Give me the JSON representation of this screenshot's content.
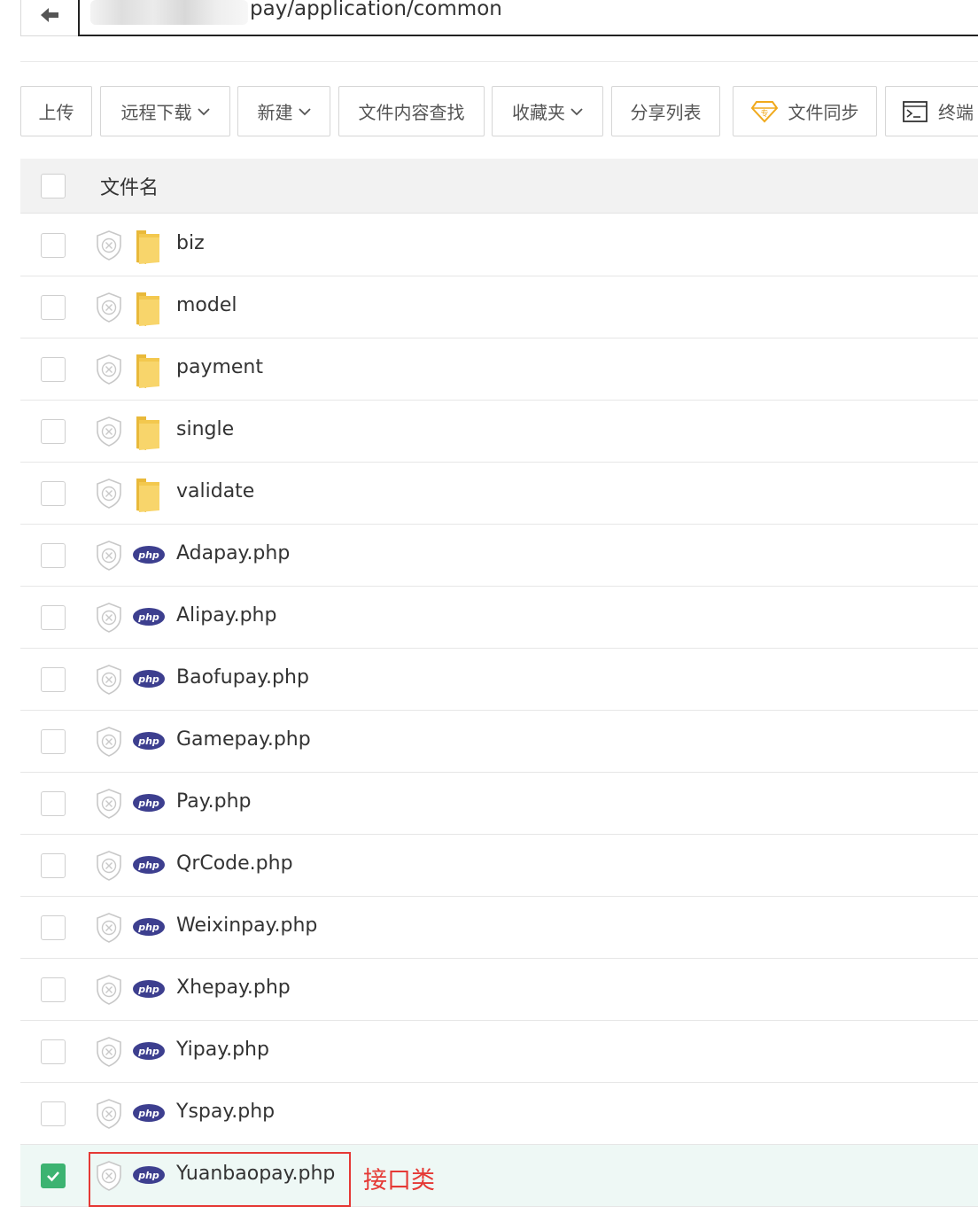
{
  "path": {
    "visible_text": "pay/application/common"
  },
  "toolbar": {
    "upload": "上传",
    "remote_download": "远程下载",
    "new": "新建",
    "content_search": "文件内容查找",
    "favorites": "收藏夹",
    "share_list": "分享列表",
    "file_sync": "文件同步",
    "terminal": "终端"
  },
  "table": {
    "header_filename": "文件名",
    "rows": [
      {
        "name": "biz",
        "type": "folder"
      },
      {
        "name": "model",
        "type": "folder"
      },
      {
        "name": "payment",
        "type": "folder"
      },
      {
        "name": "single",
        "type": "folder"
      },
      {
        "name": "validate",
        "type": "folder"
      },
      {
        "name": "Adapay.php",
        "type": "php"
      },
      {
        "name": "Alipay.php",
        "type": "php"
      },
      {
        "name": "Baofupay.php",
        "type": "php"
      },
      {
        "name": "Gamepay.php",
        "type": "php"
      },
      {
        "name": "Pay.php",
        "type": "php"
      },
      {
        "name": "QrCode.php",
        "type": "php"
      },
      {
        "name": "Weixinpay.php",
        "type": "php"
      },
      {
        "name": "Xhepay.php",
        "type": "php"
      },
      {
        "name": "Yipay.php",
        "type": "php"
      },
      {
        "name": "Yspay.php",
        "type": "php"
      },
      {
        "name": "Yuanbaopay.php",
        "type": "php",
        "checked": true
      }
    ]
  },
  "icons": {
    "php_label": "php"
  },
  "annotation": {
    "text": "接口类"
  },
  "colors": {
    "accent_green": "#3cb371",
    "annotation_red": "#e53935",
    "folder_yellow": "#f5c94a",
    "php_blue": "#3d3f8f"
  }
}
